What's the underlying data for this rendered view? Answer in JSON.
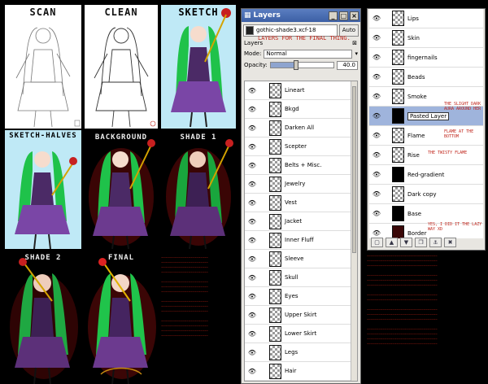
{
  "panels": [
    {
      "id": "scan",
      "label": "SCAN"
    },
    {
      "id": "clean",
      "label": "CLEAN"
    },
    {
      "id": "sketch",
      "label": "SKETCH"
    },
    {
      "id": "sketch-halves",
      "label": "SKETCH-HALVES"
    },
    {
      "id": "background",
      "label": "BACKGROUND"
    },
    {
      "id": "shade1",
      "label": "SHADE 1"
    },
    {
      "id": "shade2",
      "label": "SHADE 2"
    },
    {
      "id": "final",
      "label": "FINAL"
    }
  ],
  "layers_dock": {
    "title": "Layers",
    "image": "gothic-shade3.xcf-18",
    "auto_label": "Auto",
    "tab_label": "Layers",
    "annotation": "LAYERS FOR THE FINAL THING.",
    "mode_label": "Mode:",
    "mode_value": "Normal",
    "opacity_label": "Opacity:",
    "opacity_value": "40.0",
    "opacity_fraction": 0.4,
    "layers": [
      "Lineart",
      "Bkgd",
      "Darken All",
      "Scepter",
      "Belts + Misc.",
      "Jewelry",
      "Vest",
      "Jacket",
      "Inner Fluff",
      "Sleeve",
      "Skull",
      "Eyes",
      "Upper Skirt",
      "Lower Skirt",
      "Legs",
      "Hair"
    ]
  },
  "second_dock": {
    "layers": [
      {
        "name": "Lips",
        "thumb": "checker"
      },
      {
        "name": "Skin",
        "thumb": "checker"
      },
      {
        "name": "fingernails",
        "thumb": "checker"
      },
      {
        "name": "Beads",
        "thumb": "checker"
      },
      {
        "name": "Smoke",
        "thumb": "checker"
      },
      {
        "name": "Pasted Layer",
        "thumb": "black",
        "active": true
      },
      {
        "name": "Flame",
        "thumb": "checker"
      },
      {
        "name": "Rise",
        "thumb": "checker"
      },
      {
        "name": "Red-gradient",
        "thumb": "black"
      },
      {
        "name": "Dark copy",
        "thumb": "checker"
      },
      {
        "name": "Base",
        "thumb": "black"
      },
      {
        "name": "Border",
        "thumb": "dred"
      }
    ],
    "notes": {
      "smoke": "THE SLIGHT DARK AURA AROUND HER",
      "flame": "FLAME AT THE BOTTOM",
      "rise": "THE TWISTY FLAME",
      "border": "YES, I DID IT THE LAZY WAY XD"
    }
  },
  "colors": {
    "titlebar": "#4a6db3",
    "note_red": "#c0261c",
    "hair_green": "#1fc24a",
    "dress_purple": "#6c3a8f"
  }
}
